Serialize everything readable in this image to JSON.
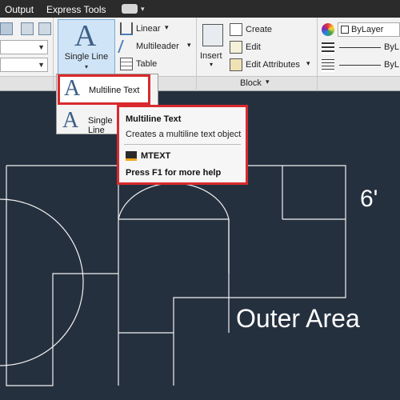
{
  "tabs": {
    "output": "Output",
    "express_tools": "Express Tools"
  },
  "ribbon": {
    "single_line": {
      "label": "Single Line"
    },
    "annotation": {
      "linear": "Linear",
      "multileader": "Multileader",
      "table": "Table"
    },
    "block": {
      "insert": "Insert",
      "create": "Create",
      "edit": "Edit",
      "edit_attributes": "Edit Attributes",
      "panel_title": "Block"
    },
    "properties": {
      "color": "ByLayer",
      "linetype": "ByL",
      "lineweight": "ByL"
    }
  },
  "text_menu": {
    "items": [
      {
        "label": "Multiline Text"
      },
      {
        "label": "Single Line"
      }
    ]
  },
  "tooltip": {
    "title": "Multiline Text",
    "description": "Creates a multiline text object",
    "command": "MTEXT",
    "help": "Press F1 for more help"
  },
  "drawing": {
    "dimension": "6'",
    "room_label": "Outer Area"
  },
  "colors": {
    "canvas": "#25303f",
    "highlight": "#d82a2e",
    "ribbon_bg": "#f2f2f2",
    "button_active": "#cfe4f7"
  }
}
